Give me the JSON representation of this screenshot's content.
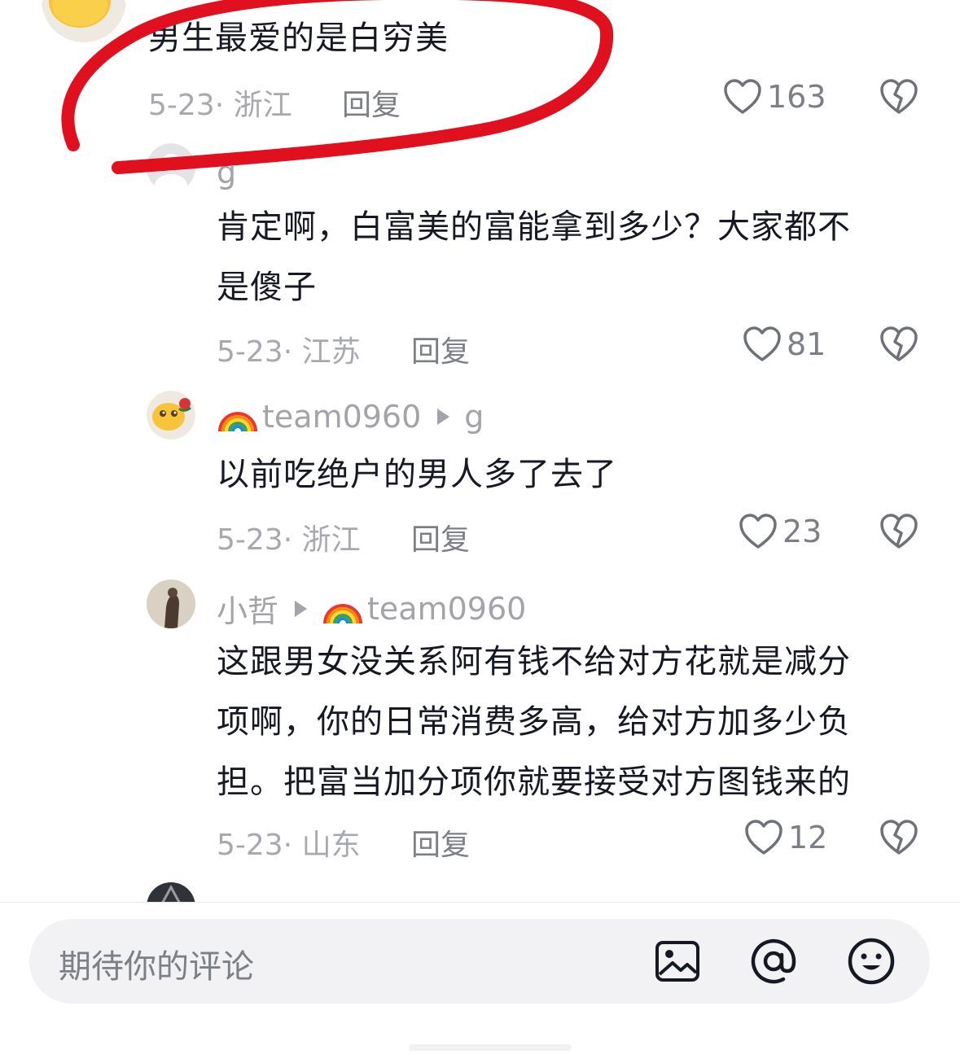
{
  "comments": [
    {
      "text": "男生最爱的是白穷美",
      "date_location": "5-23· 浙江",
      "reply_label": "回复",
      "likes": "163"
    },
    {
      "username": "g",
      "text_line1": "肯定啊，白富美的富能拿到多少？大家都不",
      "text_line2": "是傻子",
      "date_location": "5-23· 江苏",
      "reply_label": "回复",
      "likes": "81"
    },
    {
      "username": "team0960",
      "reply_to": "g",
      "text": "以前吃绝户的男人多了去了",
      "date_location": "5-23· 浙江",
      "reply_label": "回复",
      "likes": "23"
    },
    {
      "username": "小哲",
      "reply_to": "team0960",
      "text_line1": "这跟男女没关系阿有钱不给对方花就是减分",
      "text_line2": "项啊，你的日常消费多高，给对方加多少负",
      "text_line3": "担。把富当加分项你就要接受对方图钱来的",
      "date_location": "5-23· 山东",
      "reply_label": "回复",
      "likes": "12"
    }
  ],
  "input": {
    "placeholder": "期待你的评论"
  },
  "icons": {
    "like": "heart-outline-icon",
    "dislike": "broken-heart-icon",
    "image": "image-icon",
    "mention": "at-mention-icon",
    "emoji": "emoji-icon",
    "rainbow": "rainbow-emoji"
  },
  "colors": {
    "annotation_circle": "#e0101e",
    "meta_text": "#a8a9ae",
    "primary_text": "#161823"
  }
}
